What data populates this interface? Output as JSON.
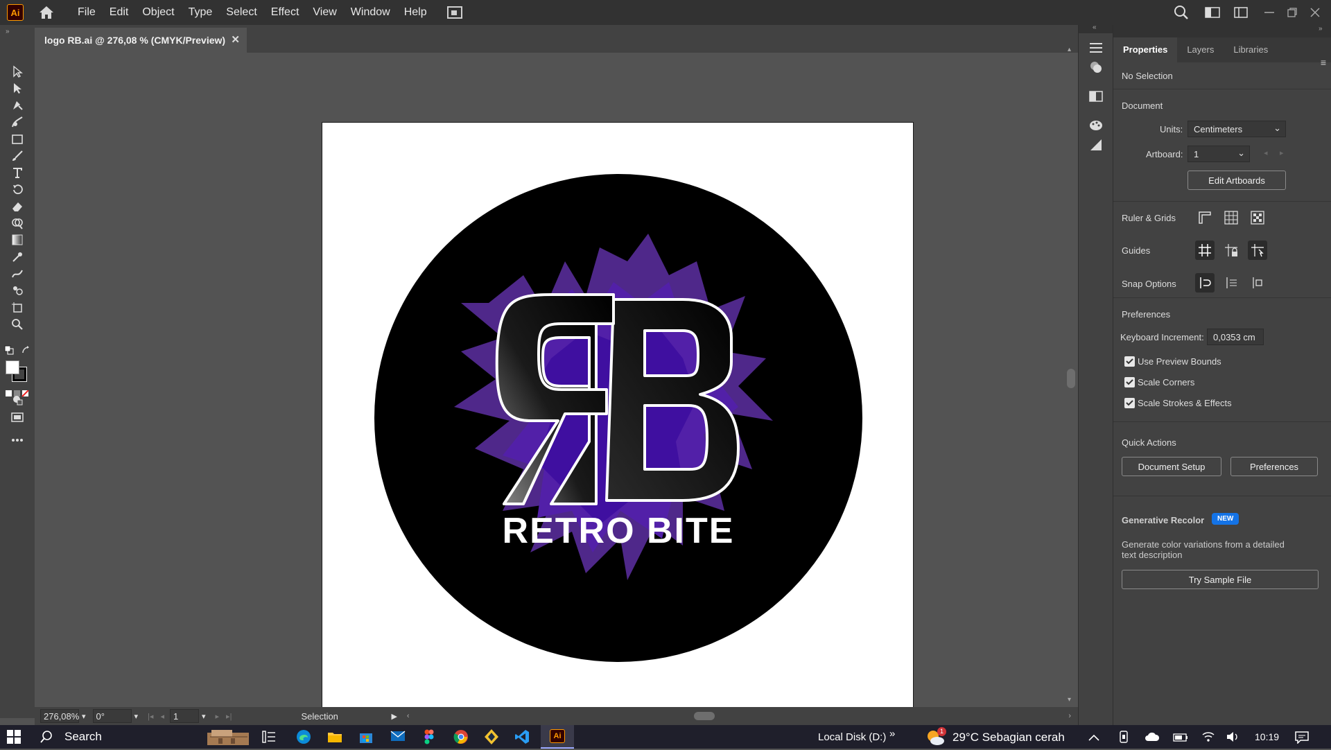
{
  "app": {
    "logo_text": "Ai",
    "menu": [
      "File",
      "Edit",
      "Object",
      "Type",
      "Select",
      "Effect",
      "View",
      "Window",
      "Help"
    ]
  },
  "document_tab": {
    "title": "logo RB.ai @ 276,08 % (CMYK/Preview)",
    "close": "✕"
  },
  "artwork": {
    "brand_text": "RETRO BITE",
    "colors": {
      "circle": "#000000",
      "purple": "#5b1fa8",
      "purple_light": "#8a56d8"
    }
  },
  "statusbar": {
    "zoom": "276,08%",
    "rotation": "0°",
    "artboard": "1",
    "tool": "Selection"
  },
  "panel": {
    "tabs": [
      "Properties",
      "Layers",
      "Libraries"
    ],
    "no_selection": "No Selection",
    "document_header": "Document",
    "units_label": "Units:",
    "units_value": "Centimeters",
    "artboard_label": "Artboard:",
    "artboard_value": "1",
    "edit_artboards": "Edit Artboards",
    "ruler_grids": "Ruler & Grids",
    "guides": "Guides",
    "snap_options": "Snap Options",
    "preferences_header": "Preferences",
    "keyboard_increment_label": "Keyboard Increment:",
    "keyboard_increment_value": "0,0353 cm",
    "use_preview_bounds": "Use Preview Bounds",
    "scale_corners": "Scale Corners",
    "scale_strokes": "Scale Strokes & Effects",
    "quick_actions": "Quick Actions",
    "document_setup": "Document Setup",
    "preferences_btn": "Preferences",
    "gen_recolor": "Generative Recolor",
    "new_badge": "NEW",
    "gen_desc": "Generate color variations from a detailed text description",
    "try_sample": "Try Sample File"
  },
  "taskbar": {
    "search": "Search",
    "local_disk": "Local Disk (D:)",
    "chevron": "»",
    "weather": "29°C  Sebagian cerah",
    "weather_badge": "1",
    "time": "10:19"
  }
}
